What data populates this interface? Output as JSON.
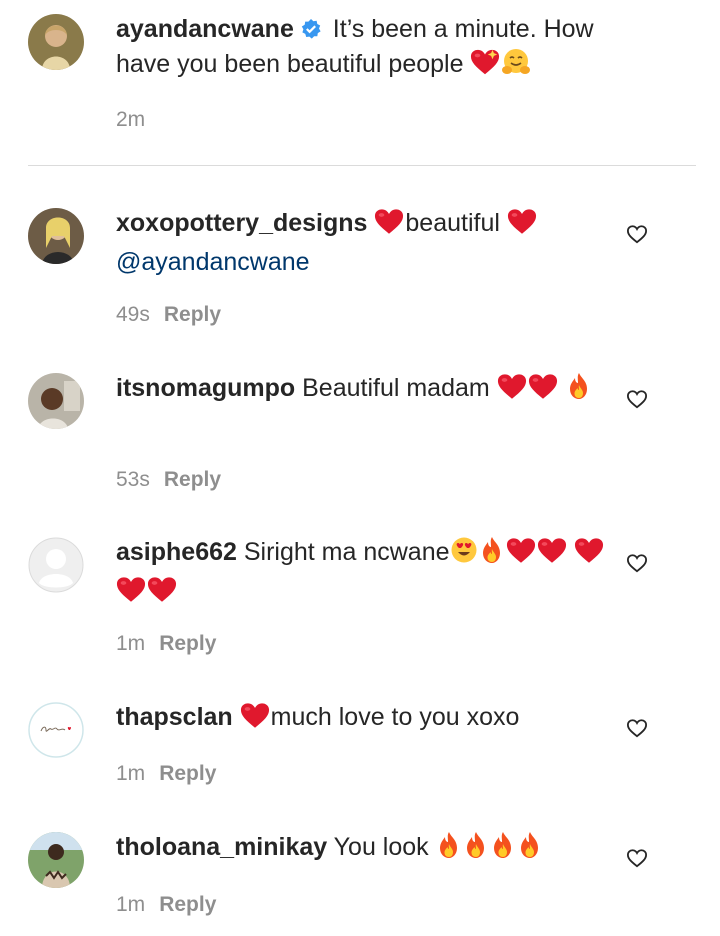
{
  "caption": {
    "username": "ayandancwane",
    "text": " It’s been a minute. How have you been beautiful people",
    "time": "2m"
  },
  "reply_label": "Reply",
  "comments": [
    {
      "username": "xoxopottery_designs",
      "t1": "beautiful ",
      "mention": "@ayandancwane",
      "time": "49s"
    },
    {
      "username": "itsnomagumpo",
      "t1": " Beautiful madam ",
      "time": "53s"
    },
    {
      "username": "asiphe662",
      "t1": " Siright ma ncwane",
      "time": "1m"
    },
    {
      "username": "thapsclan",
      "t1": "much love to you xoxo",
      "time": "1m"
    },
    {
      "username": "tholoana_minikay",
      "t1": " You look ",
      "time": "1m"
    }
  ],
  "colors": {
    "username": "#262626",
    "meta": "#8e8e8e",
    "mention": "#00376b",
    "heart": "#e0182d",
    "verified": "#3897f0"
  },
  "icons": [
    "verified-badge-icon",
    "red-heart-emoji",
    "fire-emoji",
    "heart-eyes-emoji",
    "sparkling-heart-emoji",
    "hugging-face-emoji",
    "like-heart-outline-icon"
  ],
  "avatar_logo_text": "Thapsclan"
}
